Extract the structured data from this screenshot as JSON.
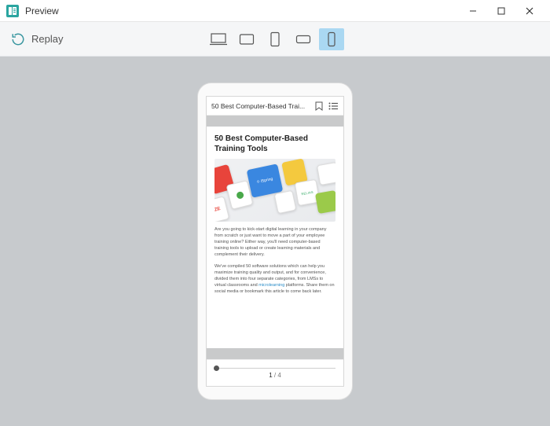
{
  "window": {
    "title": "Preview"
  },
  "toolbar": {
    "replay_label": "Replay"
  },
  "document": {
    "header_title": "50 Best Computer-Based Trai...",
    "heading": "50 Best Computer-Based Training Tools",
    "paragraph1": "Are you going to kick-start digital learning in your company from scratch or just want to move a part of your employee training online? Either way, you'll need computer-based training tools to upload or create learning materials and complement their delivery.",
    "paragraph2_pre": "We've compiled 50 software solutions which can help you maximize training quality and output, and for convenience, divided them into four separate categories, from LMSs to virtual classrooms and ",
    "paragraph2_link": "microlearning",
    "paragraph2_post": " platforms. Share them on social media or bookmark this article to come back later.",
    "pager": {
      "current": "1",
      "total": "4",
      "sep": " / "
    }
  }
}
